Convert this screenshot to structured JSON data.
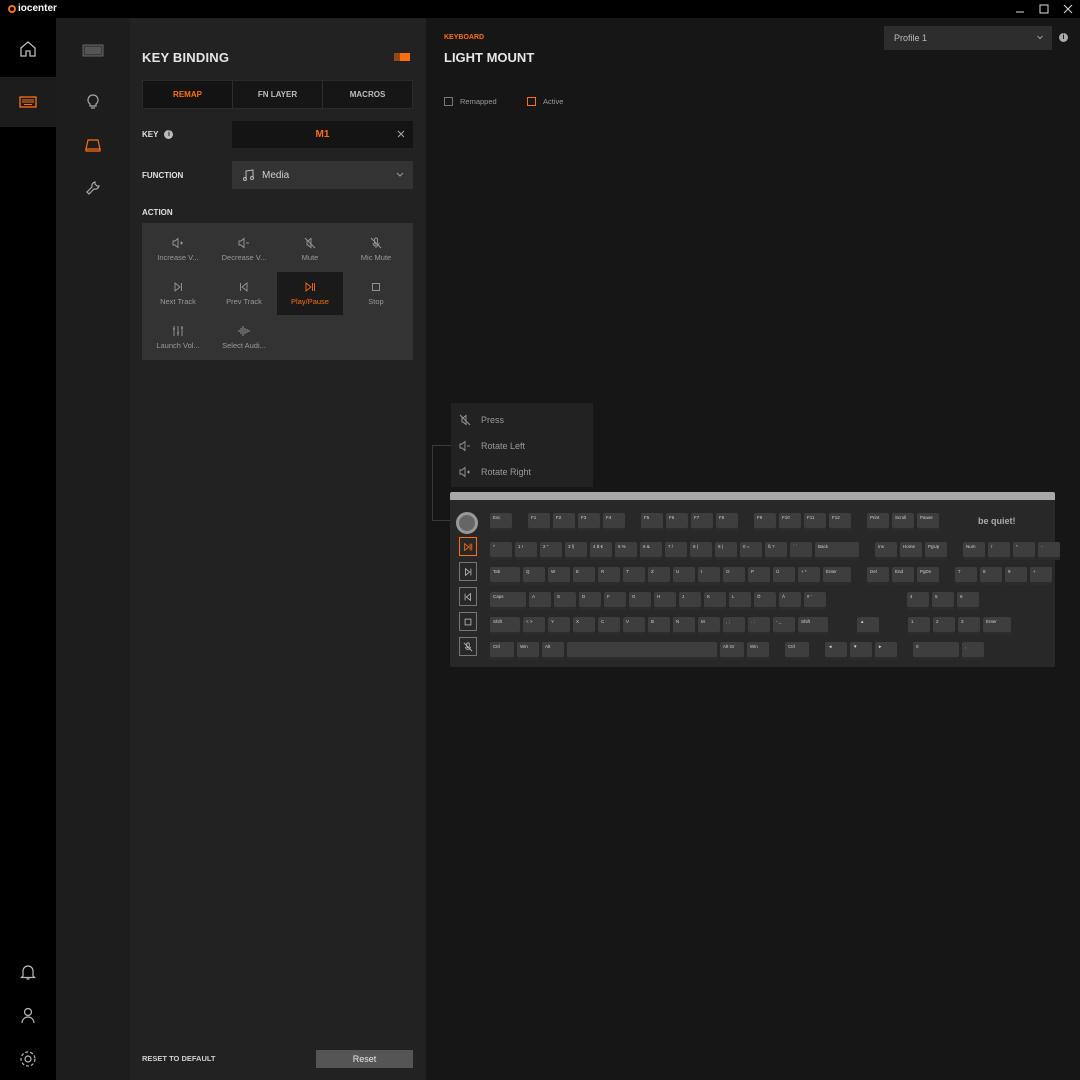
{
  "app": {
    "brand": "iocenter"
  },
  "titlebar": {
    "minimize_icon": "minimize-icon",
    "maximize_icon": "maximize-icon",
    "close_icon": "close-icon"
  },
  "rail": {
    "items": [
      "home-icon",
      "keyboard-icon"
    ],
    "bottom": [
      "bell-icon",
      "user-icon",
      "settings-icon"
    ]
  },
  "subrail": {
    "items": [
      "device-thumbnail",
      "lightbulb-icon",
      "keycap-icon",
      "wrench-icon"
    ]
  },
  "panel": {
    "title": "KEY BINDING",
    "tabs": [
      {
        "label": "REMAP",
        "active": true
      },
      {
        "label": "FN LAYER",
        "active": false
      },
      {
        "label": "MACROS",
        "active": false
      }
    ],
    "key_label": "KEY",
    "key_info": "i",
    "key_value": "M1",
    "function_label": "FUNCTION",
    "function_value": "Media",
    "action_label": "ACTION",
    "actions": [
      {
        "label": "Increase V...",
        "icon": "volume-up-icon",
        "active": false
      },
      {
        "label": "Decrease V...",
        "icon": "volume-down-icon",
        "active": false
      },
      {
        "label": "Mute",
        "icon": "mute-icon",
        "active": false
      },
      {
        "label": "Mic Mute",
        "icon": "mic-mute-icon",
        "active": false
      },
      {
        "label": "Next Track",
        "icon": "next-track-icon",
        "active": false
      },
      {
        "label": "Prev Track",
        "icon": "prev-track-icon",
        "active": false
      },
      {
        "label": "Play/Pause",
        "icon": "play-pause-icon",
        "active": true
      },
      {
        "label": "Stop",
        "icon": "stop-icon",
        "active": false
      },
      {
        "label": "Launch Vol...",
        "icon": "mixer-icon",
        "active": false
      },
      {
        "label": "Select Audi...",
        "icon": "audio-wave-icon",
        "active": false
      }
    ],
    "reset_default_label": "RESET TO DEFAULT",
    "reset_button": "Reset"
  },
  "main": {
    "crumb": "KEYBOARD",
    "title": "LIGHT MOUNT",
    "profile": "Profile 1",
    "info": "i",
    "legend": [
      {
        "label": "Remapped",
        "color": "#777777"
      },
      {
        "label": "Active",
        "color": "#ff6e0d"
      }
    ],
    "knob_popup": [
      {
        "label": "Press",
        "icon": "mute-icon"
      },
      {
        "label": "Rotate Left",
        "icon": "volume-down-icon"
      },
      {
        "label": "Rotate Right",
        "icon": "volume-up-icon"
      }
    ],
    "keyboard_logo": "be quiet!",
    "keyboard_rows": [
      [
        "Esc",
        "",
        "F1",
        "F2",
        "F3",
        "F4",
        "",
        "F5",
        "F6",
        "F7",
        "F8",
        "",
        "F9",
        "F10",
        "F11",
        "F12",
        "",
        "Print",
        "Scroll",
        "Pause"
      ],
      [
        "^",
        "1 !",
        "2 \"",
        "3 §",
        "4 $ €",
        "5 %",
        "6 &",
        "7 /",
        "8 (",
        "9 )",
        "0 =",
        "ß ?",
        "´ `",
        "Back",
        "",
        "Ins",
        "Home",
        "PgUp",
        "",
        "Num",
        "/",
        "*",
        "-"
      ],
      [
        "Tab",
        "Q",
        "W",
        "E",
        "R",
        "T",
        "Z",
        "U",
        "I",
        "O",
        "P",
        "Ü",
        "+ *",
        "Enter",
        "",
        "Del",
        "End",
        "PgDn",
        "",
        "7",
        "8",
        "9",
        "+"
      ],
      [
        "Caps",
        "A",
        "S",
        "D",
        "F",
        "G",
        "H",
        "J",
        "K",
        "L",
        "Ö",
        "Ä",
        "# '",
        "",
        "",
        "",
        "",
        "",
        "",
        "4",
        "5",
        "6",
        ""
      ],
      [
        "Shift",
        "< >",
        "Y",
        "X",
        "C",
        "V",
        "B",
        "N",
        "M",
        ", ;",
        ". :",
        "- _",
        "Shift",
        "",
        "",
        "▲",
        "",
        "",
        "1",
        "2",
        "3",
        "Enter"
      ],
      [
        "Ctrl",
        "Win",
        "Alt",
        "",
        "Alt Gr",
        "Win",
        "",
        "Ctrl",
        "",
        "◄",
        "▼",
        "►",
        "",
        "0",
        ","
      ]
    ],
    "accent": "#ff6e0d"
  }
}
